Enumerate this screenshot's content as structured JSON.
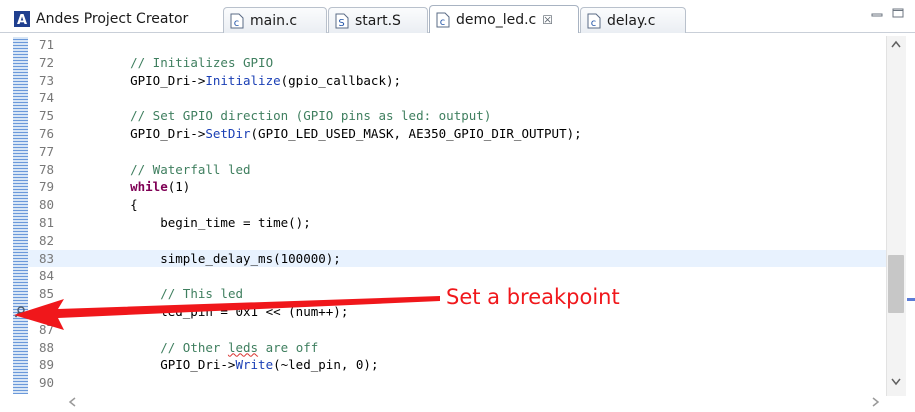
{
  "tabs": [
    {
      "label": "Andes Project Creator",
      "icon": "andes-logo-icon",
      "active": false
    },
    {
      "label": "main.c",
      "icon": "c-file-icon",
      "active": false
    },
    {
      "label": "start.S",
      "icon": "s-file-icon",
      "active": false
    },
    {
      "label": "demo_led.c",
      "icon": "c-file-icon",
      "active": true,
      "close": "☒"
    },
    {
      "label": "delay.c",
      "icon": "c-file-icon",
      "active": false
    }
  ],
  "editor": {
    "current_line": 83,
    "breakpoint_line": 86,
    "lines": [
      {
        "num": "71",
        "text": ""
      },
      {
        "num": "72",
        "text": "    // Initializes GPIO"
      },
      {
        "num": "73",
        "text": "    GPIO_Dri->Initialize(gpio_callback);"
      },
      {
        "num": "74",
        "text": ""
      },
      {
        "num": "75",
        "text": "    // Set GPIO direction (GPIO pins as led: output)"
      },
      {
        "num": "76",
        "text": "    GPIO_Dri->SetDir(GPIO_LED_USED_MASK, AE350_GPIO_DIR_OUTPUT);"
      },
      {
        "num": "77",
        "text": ""
      },
      {
        "num": "78",
        "text": "    // Waterfall led"
      },
      {
        "num": "79",
        "text": "    while(1)"
      },
      {
        "num": "80",
        "text": "    {"
      },
      {
        "num": "81",
        "text": "        begin_time = time();"
      },
      {
        "num": "82",
        "text": ""
      },
      {
        "num": "83",
        "text": "        simple_delay_ms(100000);"
      },
      {
        "num": "84",
        "text": ""
      },
      {
        "num": "85",
        "text": "        // This led"
      },
      {
        "num": "86",
        "text": "        led_pin = 0x1 << (num++);"
      },
      {
        "num": "87",
        "text": ""
      },
      {
        "num": "88",
        "text": "        // Other leds are off"
      },
      {
        "num": "89",
        "text": "        GPIO_Dri->Write(~led_pin, 0);"
      },
      {
        "num": "90",
        "text": ""
      }
    ]
  },
  "annotation": {
    "label": "Set a breakpoint",
    "color": "#f0171b"
  },
  "colors": {
    "comment": "#3f7f5f",
    "keyword": "#7f0055",
    "method": "#1a3fb5",
    "current_line_bg": "#e8f2fe"
  }
}
